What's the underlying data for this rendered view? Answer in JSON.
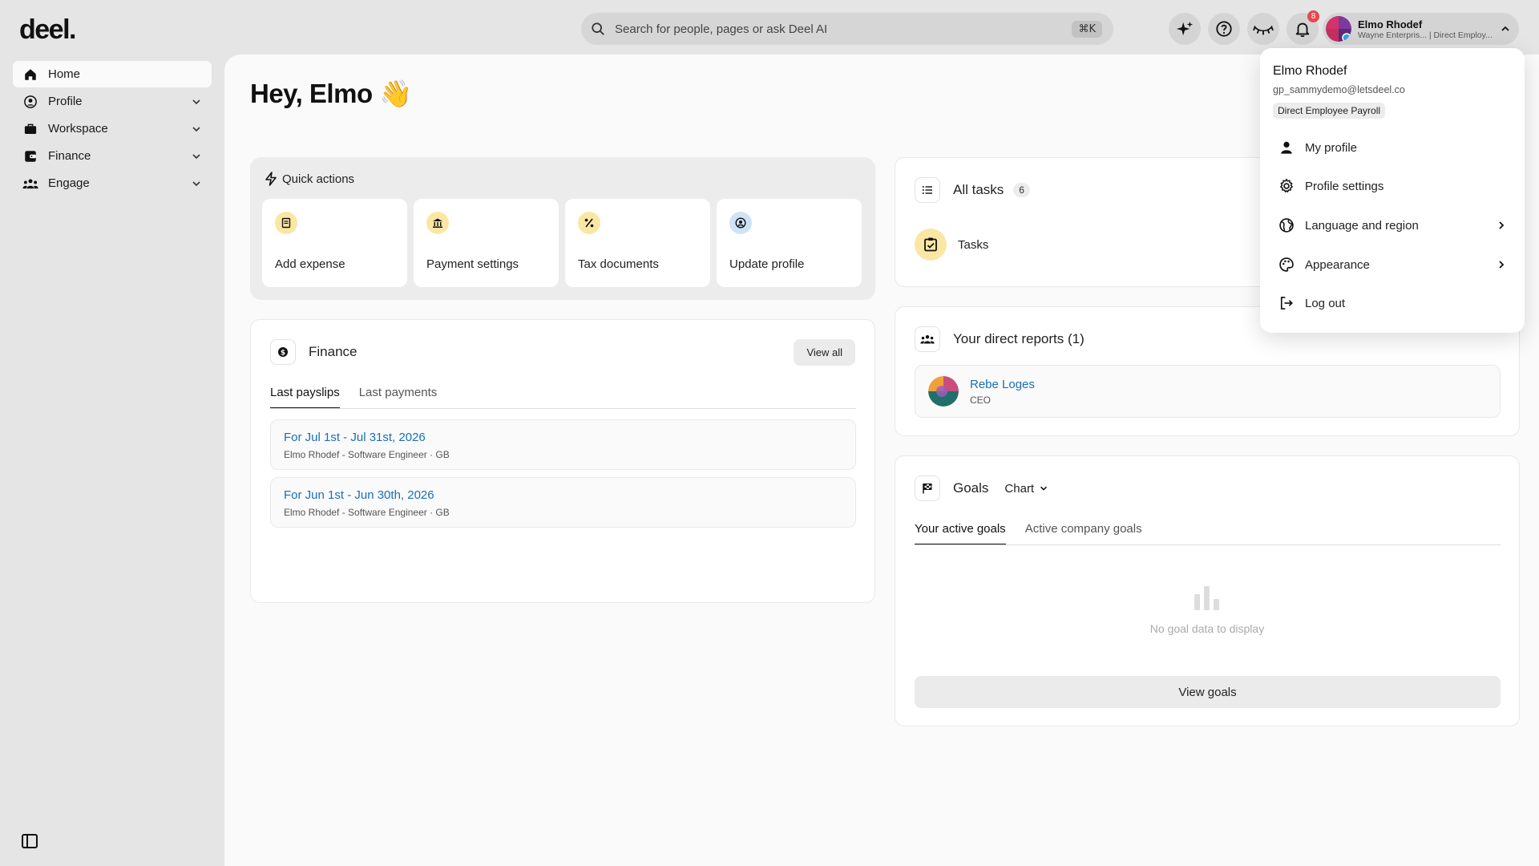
{
  "app": {
    "logo": "deel."
  },
  "sidebar": {
    "items": [
      {
        "label": "Home",
        "icon": "home-icon",
        "active": true
      },
      {
        "label": "Profile",
        "icon": "profile-icon"
      },
      {
        "label": "Workspace",
        "icon": "briefcase-icon"
      },
      {
        "label": "Finance",
        "icon": "wallet-icon"
      },
      {
        "label": "Engage",
        "icon": "people-icon"
      }
    ]
  },
  "header": {
    "search_placeholder": "Search for people, pages or ask Deel AI",
    "search_shortcut": "⌘K",
    "notifications_count": "8",
    "user": {
      "name": "Elmo Rhodef",
      "subtitle": "Wayne Enterpris... | Direct Employ..."
    }
  },
  "main": {
    "greeting": "Hey, Elmo",
    "greeting_emoji": "👋",
    "quick_actions": {
      "title": "Quick actions",
      "items": [
        {
          "label": "Add expense",
          "icon": "receipt-icon",
          "color": "#fbe7a4"
        },
        {
          "label": "Payment settings",
          "icon": "bank-icon",
          "color": "#fbe7a4"
        },
        {
          "label": "Tax documents",
          "icon": "percent-icon",
          "color": "#fbe7a4"
        },
        {
          "label": "Update profile",
          "icon": "user-circle-icon",
          "color": "#cfe3f7"
        }
      ]
    },
    "finance": {
      "title": "Finance",
      "view_all": "View all",
      "tabs": [
        "Last payslips",
        "Last payments"
      ],
      "payslips": [
        {
          "title": "For Jul 1st - Jul 31st, 2026",
          "subtitle": "Elmo Rhodef - Software Engineer · GB"
        },
        {
          "title": "For Jun 1st - Jun 30th, 2026",
          "subtitle": "Elmo Rhodef - Software Engineer · GB"
        }
      ]
    },
    "tasks": {
      "title": "All tasks",
      "count": "6",
      "item_label": "Tasks"
    },
    "reports": {
      "title": "Your direct reports (1)",
      "person": {
        "name": "Rebe Loges",
        "role": "CEO"
      }
    },
    "goals": {
      "title": "Goals",
      "view_select": "Chart",
      "tabs": [
        "Your active goals",
        "Active company goals"
      ],
      "empty_text": "No goal data to display",
      "view_button": "View goals"
    }
  },
  "dropdown": {
    "name": "Elmo Rhodef",
    "email": "gp_sammydemo@letsdeel.co",
    "tag": "Direct Employee Payroll",
    "items": [
      {
        "label": "My profile",
        "icon": "person-icon"
      },
      {
        "label": "Profile settings",
        "icon": "gear-icon"
      },
      {
        "label": "Language and region",
        "icon": "globe-icon",
        "submenu": true
      },
      {
        "label": "Appearance",
        "icon": "palette-icon",
        "submenu": true
      },
      {
        "label": "Log out",
        "icon": "logout-icon"
      }
    ]
  },
  "colors": {
    "accent_link": "#1a6fb5",
    "badge_red": "#e5484d",
    "highlight_yellow": "#fbe7a4"
  }
}
